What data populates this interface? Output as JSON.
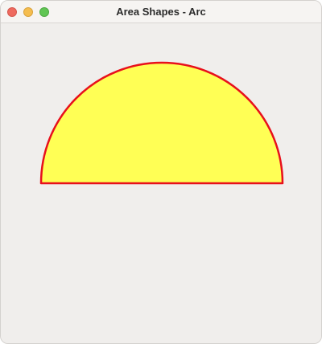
{
  "window": {
    "title": "Area Shapes - Arc"
  },
  "shape": {
    "type": "arc",
    "start_angle_deg": 0,
    "extent_deg": 180,
    "fill_color": "#ffff55",
    "stroke_color": "#e8101b"
  },
  "icons": {
    "close": "close-icon",
    "minimize": "minimize-icon",
    "zoom": "zoom-icon"
  }
}
